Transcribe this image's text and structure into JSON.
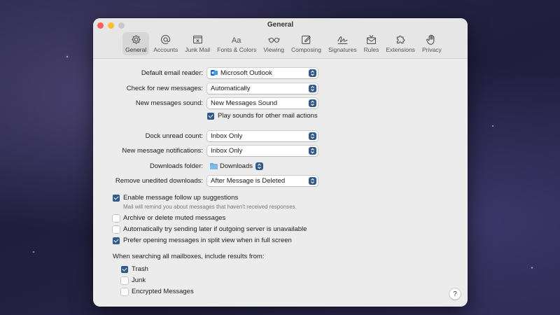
{
  "window": {
    "title": "General"
  },
  "toolbar": {
    "tabs": [
      {
        "label": "General",
        "icon": "gear-icon",
        "active": true
      },
      {
        "label": "Accounts",
        "icon": "at-icon",
        "active": false
      },
      {
        "label": "Junk Mail",
        "icon": "junk-tray-icon",
        "active": false
      },
      {
        "label": "Fonts & Colors",
        "icon": "fonts-icon",
        "active": false
      },
      {
        "label": "Viewing",
        "icon": "glasses-icon",
        "active": false
      },
      {
        "label": "Composing",
        "icon": "compose-icon",
        "active": false
      },
      {
        "label": "Signatures",
        "icon": "signature-icon",
        "active": false
      },
      {
        "label": "Rules",
        "icon": "rules-envelope-icon",
        "active": false
      },
      {
        "label": "Extensions",
        "icon": "puzzle-icon",
        "active": false
      },
      {
        "label": "Privacy",
        "icon": "hand-icon",
        "active": false
      }
    ]
  },
  "settings": {
    "default_reader": {
      "label": "Default email reader:",
      "value": "Microsoft Outlook"
    },
    "check_new": {
      "label": "Check for new messages:",
      "value": "Automatically"
    },
    "new_sound": {
      "label": "New messages sound:",
      "value": "New Messages Sound"
    },
    "play_sounds": {
      "label": "Play sounds for other mail actions",
      "checked": true
    },
    "dock_unread": {
      "label": "Dock unread count:",
      "value": "Inbox Only"
    },
    "new_notifications": {
      "label": "New message notifications:",
      "value": "Inbox Only"
    },
    "downloads_folder": {
      "label": "Downloads folder:",
      "value": "Downloads"
    },
    "remove_unedited": {
      "label": "Remove unedited downloads:",
      "value": "After Message is Deleted"
    }
  },
  "options": {
    "follow_up": {
      "label": "Enable message follow up suggestions",
      "checked": true,
      "note": "Mail will remind you about messages that haven't received responses."
    },
    "archive_muted": {
      "label": "Archive or delete muted messages",
      "checked": false
    },
    "auto_send_later": {
      "label": "Automatically try sending later if outgoing server is unavailable",
      "checked": false
    },
    "split_view": {
      "label": "Prefer opening messages in split view when in full screen",
      "checked": true
    }
  },
  "search": {
    "heading": "When searching all mailboxes, include results from:",
    "trash": {
      "label": "Trash",
      "checked": true
    },
    "junk": {
      "label": "Junk",
      "checked": false
    },
    "encrypted": {
      "label": "Encrypted Messages",
      "checked": false
    }
  },
  "help": {
    "label": "?"
  },
  "colors": {
    "accent": "#2f5a8a",
    "window_bg": "#ececec",
    "close": "#ff5f57",
    "minimize": "#febc2e"
  }
}
